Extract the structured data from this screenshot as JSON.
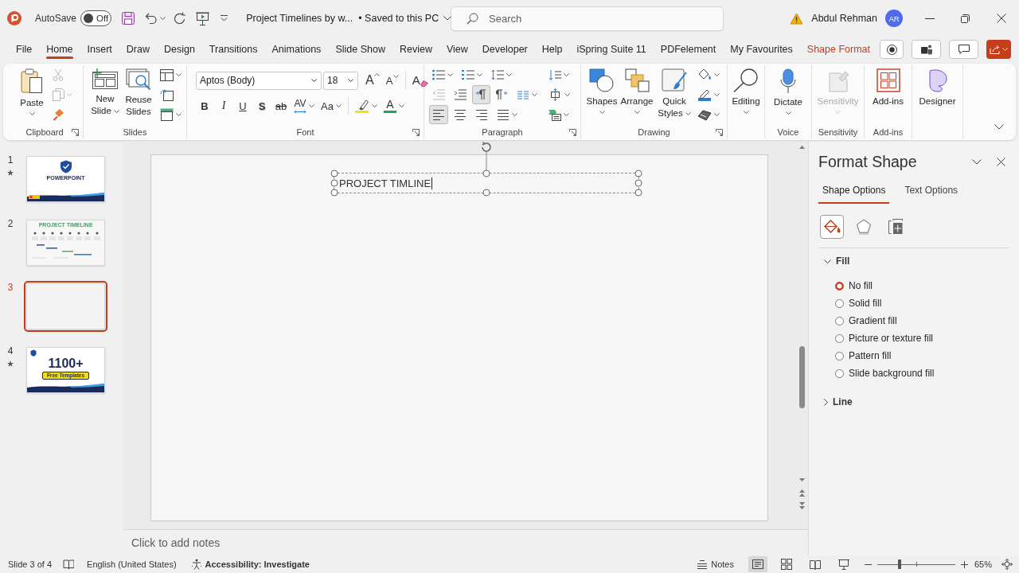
{
  "title_bar": {
    "autosave_label": "AutoSave",
    "autosave_toggle": {
      "label": "Off",
      "on": false
    },
    "document_title": "Project Timelines by w...",
    "save_status": "• Saved to this PC",
    "search": {
      "placeholder": "Search"
    },
    "user_name": "Abdul Rehman",
    "avatar_initials": "AR"
  },
  "menu_tabs": [
    {
      "label": "File",
      "selected": false,
      "kind": "tab"
    },
    {
      "label": "Home",
      "selected": true,
      "kind": "tab"
    },
    {
      "label": "Insert",
      "selected": false,
      "kind": "tab"
    },
    {
      "label": "Draw",
      "selected": false,
      "kind": "tab"
    },
    {
      "label": "Design",
      "selected": false,
      "kind": "tab"
    },
    {
      "label": "Transitions",
      "selected": false,
      "kind": "tab"
    },
    {
      "label": "Animations",
      "selected": false,
      "kind": "tab"
    },
    {
      "label": "Slide Show",
      "selected": false,
      "kind": "tab"
    },
    {
      "label": "Review",
      "selected": false,
      "kind": "tab"
    },
    {
      "label": "View",
      "selected": false,
      "kind": "tab"
    },
    {
      "label": "Developer",
      "selected": false,
      "kind": "tab"
    },
    {
      "label": "Help",
      "selected": false,
      "kind": "tab"
    },
    {
      "label": "iSpring Suite 11",
      "selected": false,
      "kind": "tab"
    },
    {
      "label": "PDFelement",
      "selected": false,
      "kind": "tab"
    },
    {
      "label": "My Favourites",
      "selected": false,
      "kind": "tab"
    },
    {
      "label": "Shape Format",
      "selected": false,
      "kind": "contextual"
    }
  ],
  "ribbon": {
    "clipboard": {
      "label": "Clipboard",
      "paste": "Paste",
      "cut": {
        "disabled": true
      },
      "copy": {
        "disabled": true
      }
    },
    "slides": {
      "label": "Slides",
      "new_slide": "New Slide",
      "reuse_slides": "Reuse Slides"
    },
    "font": {
      "label": "Font",
      "font_name": "Aptos (Body)",
      "font_size": "18",
      "grow_font": "A",
      "shrink_font": "A",
      "clear_formatting": "A",
      "bold": "B",
      "italic": "I",
      "underline": "U",
      "shadow": "S",
      "strikethrough": "ab",
      "character_spacing": "AV",
      "change_case": "Aa",
      "font_color": "A"
    },
    "paragraph": {
      "label": "Paragraph",
      "indent_buttons": [
        {
          "disabled": true
        },
        {
          "disabled": false
        }
      ],
      "direction_buttons": [
        {
          "selected": true
        },
        {
          "selected": false
        }
      ],
      "alignment_buttons": [
        {
          "selected": true
        },
        {
          "selected": false
        },
        {
          "selected": false
        },
        {
          "selected": false
        }
      ]
    },
    "drawing": {
      "label": "Drawing",
      "shapes": "Shapes",
      "arrange": "Arrange",
      "quick_styles": "Quick Styles"
    },
    "editing": {
      "button": "Editing"
    },
    "voice": {
      "label": "Voice",
      "dictate": "Dictate"
    },
    "sensitivity": {
      "label": "Sensitivity",
      "button": "Sensitivity",
      "disabled": true
    },
    "add_ins": {
      "label": "Add-ins",
      "button": "Add-ins"
    },
    "designer": {
      "button": "Designer"
    }
  },
  "slide_panel": {
    "slides": [
      {
        "number": "1",
        "starred": true,
        "selected": false,
        "kind": "cover",
        "texts": [
          "POWERPOINT"
        ]
      },
      {
        "number": "2",
        "starred": false,
        "selected": false,
        "kind": "timeline",
        "texts": [
          "PROJECT TIMELINE"
        ]
      },
      {
        "number": "3",
        "starred": false,
        "selected": true,
        "kind": "blank"
      },
      {
        "number": "4",
        "starred": true,
        "selected": false,
        "kind": "promo",
        "texts": [
          "1100+",
          "Free Templates"
        ]
      }
    ]
  },
  "slide": {
    "text_box": {
      "text": "PROJECT TIMLINE",
      "selected": true
    }
  },
  "notes": {
    "placeholder": "Click to add notes"
  },
  "format_pane": {
    "title": "Format Shape",
    "tabs": [
      {
        "label": "Shape Options",
        "selected": true
      },
      {
        "label": "Text Options",
        "selected": false
      }
    ],
    "category_buttons": [
      {
        "selected": true
      },
      {
        "selected": false
      },
      {
        "selected": false
      }
    ],
    "sections": [
      {
        "label": "Fill",
        "expanded": true,
        "options": [
          {
            "label": "No fill",
            "selected": true
          },
          {
            "label": "Solid fill",
            "selected": false
          },
          {
            "label": "Gradient fill",
            "selected": false
          },
          {
            "label": "Picture or texture fill",
            "selected": false
          },
          {
            "label": "Pattern fill",
            "selected": false
          },
          {
            "label": "Slide background fill",
            "selected": false
          }
        ]
      },
      {
        "label": "Line",
        "expanded": false
      }
    ]
  },
  "status_bar": {
    "slide_info": "Slide 3 of 4",
    "language": "English (United States)",
    "accessibility": "Accessibility: Investigate",
    "notes_button": "Notes",
    "view_buttons": [
      {
        "selected": true
      },
      {
        "selected": false
      },
      {
        "selected": false
      },
      {
        "selected": false
      }
    ],
    "zoom": {
      "level": 0.29,
      "reading": "65%"
    }
  }
}
